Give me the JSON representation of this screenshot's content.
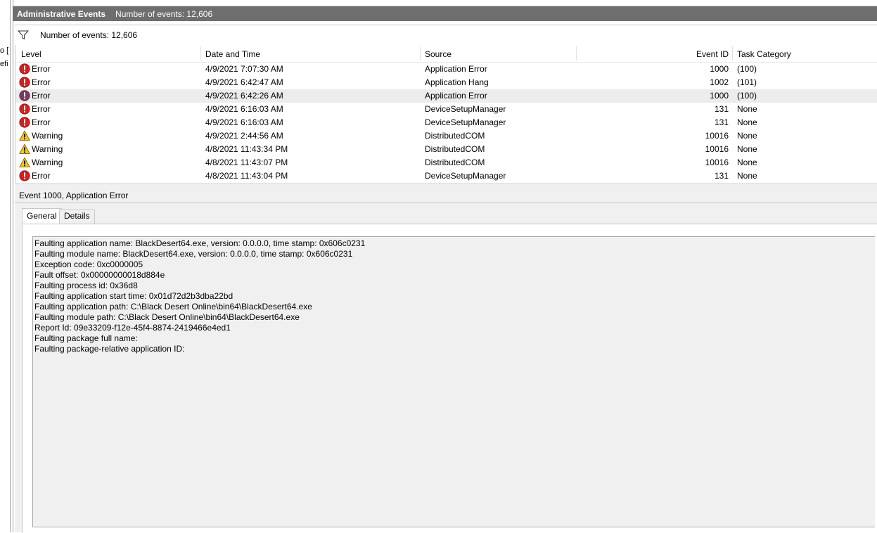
{
  "left_fragments": [
    "o [",
    "efi"
  ],
  "title_bar": {
    "title": "Administrative Events",
    "count": "Number of events: 12,606"
  },
  "filter_bar": {
    "text": "Number of events: 12,606"
  },
  "table": {
    "columns": [
      "Level",
      "Date and Time",
      "Source",
      "Event ID",
      "Task Category"
    ],
    "rows": [
      {
        "level": "Error",
        "icon": "error-icon",
        "datetime": "4/9/2021 7:07:30 AM",
        "source": "Application Error",
        "event_id": "1000",
        "category": "(100)"
      },
      {
        "level": "Error",
        "icon": "error-icon",
        "datetime": "4/9/2021 6:42:47 AM",
        "source": "Application Hang",
        "event_id": "1002",
        "category": "(101)"
      },
      {
        "level": "Error",
        "icon": "error-icon",
        "datetime": "4/9/2021 6:42:26 AM",
        "source": "Application Error",
        "event_id": "1000",
        "category": "(100)"
      },
      {
        "level": "Error",
        "icon": "error-icon",
        "datetime": "4/9/2021 6:16:03 AM",
        "source": "DeviceSetupManager",
        "event_id": "131",
        "category": "None"
      },
      {
        "level": "Error",
        "icon": "error-icon",
        "datetime": "4/9/2021 6:16:03 AM",
        "source": "DeviceSetupManager",
        "event_id": "131",
        "category": "None"
      },
      {
        "level": "Warning",
        "icon": "warning-icon",
        "datetime": "4/9/2021 2:44:56 AM",
        "source": "DistributedCOM",
        "event_id": "10016",
        "category": "None"
      },
      {
        "level": "Warning",
        "icon": "warning-icon",
        "datetime": "4/8/2021 11:43:34 PM",
        "source": "DistributedCOM",
        "event_id": "10016",
        "category": "None"
      },
      {
        "level": "Warning",
        "icon": "warning-icon",
        "datetime": "4/8/2021 11:43:07 PM",
        "source": "DistributedCOM",
        "event_id": "10016",
        "category": "None"
      },
      {
        "level": "Error",
        "icon": "error-icon",
        "datetime": "4/8/2021 11:43:04 PM",
        "source": "DeviceSetupManager",
        "event_id": "131",
        "category": "None"
      }
    ]
  },
  "detail": {
    "title": "Event 1000, Application Error",
    "tabs": [
      "General",
      "Details"
    ],
    "lines": [
      "Faulting application name: BlackDesert64.exe, version: 0.0.0.0, time stamp: 0x606c0231",
      "Faulting module name: BlackDesert64.exe, version: 0.0.0.0, time stamp: 0x606c0231",
      "Exception code: 0xc0000005",
      "Fault offset: 0x00000000018d884e",
      "Faulting process id: 0x36d8",
      "Faulting application start time: 0x01d72d2b3dba22bd",
      "Faulting application path: C:\\Black Desert Online\\bin64\\BlackDesert64.exe",
      "Faulting module path: C:\\Black Desert Online\\bin64\\BlackDesert64.exe",
      "Report Id: 09e33209-f12e-45f4-8874-2419466e4ed1",
      "Faulting package full name: ",
      "Faulting package-relative application ID: "
    ]
  }
}
